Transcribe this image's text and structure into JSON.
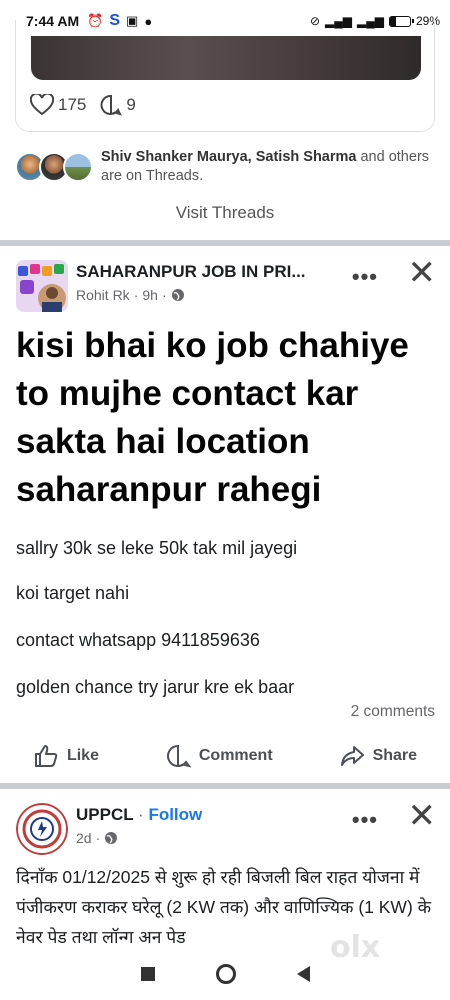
{
  "status_bar": {
    "time": "7:44 AM",
    "battery": "29%",
    "battery_level": 0.29
  },
  "threads_card": {
    "likes": "175",
    "comments": "9"
  },
  "threads_friends": {
    "names": "Shiv Shanker Maurya, Satish Sharma",
    "rest": " and others are on Threads."
  },
  "visit_threads": "Visit Threads",
  "post1": {
    "page_name": "SAHARANPUR JOB IN PRI...",
    "author": "Rohit Rk",
    "time": "9h",
    "big_text": "kisi bhai ko job chahiye to mujhe contact kar sakta hai location saharanpur rahegi",
    "lines": [
      "sallry 30k se leke 50k tak mil jayegi",
      "koi target nahi",
      "contact whatsapp 9411859636",
      "golden chance try jarur kre ek baar"
    ],
    "comments_count": "2 comments"
  },
  "actions": {
    "like": "Like",
    "comment": "Comment",
    "share": "Share"
  },
  "post2": {
    "page_name": "UPPCL",
    "follow": "Follow",
    "time": "2d",
    "text": "दिनाँक 01/12/2025 से शुरू हो रही बिजली बिल राहत योजना में पंजीकरण कराकर घरेलू (2 KW तक) और वाणिज्यिक (1 KW) के नेवर पेड तथा लॉन्ग अन पेड"
  },
  "watermark": "olx",
  "colors": {
    "accent": "#1877f2",
    "divider": "#c9ccd1"
  }
}
